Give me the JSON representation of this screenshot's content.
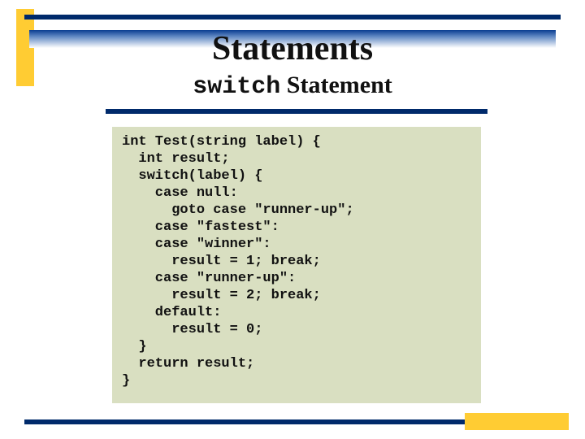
{
  "title": "Statements",
  "subtitle_keyword": "switch",
  "subtitle_rest": " Statement",
  "code": "int Test(string label) {\n  int result;\n  switch(label) {\n    case null:\n      goto case \"runner-up\";\n    case \"fastest\":\n    case \"winner\":\n      result = 1; break;\n    case \"runner-up\":\n      result = 2; break;\n    default:\n      result = 0;\n  }\n  return result;\n}"
}
